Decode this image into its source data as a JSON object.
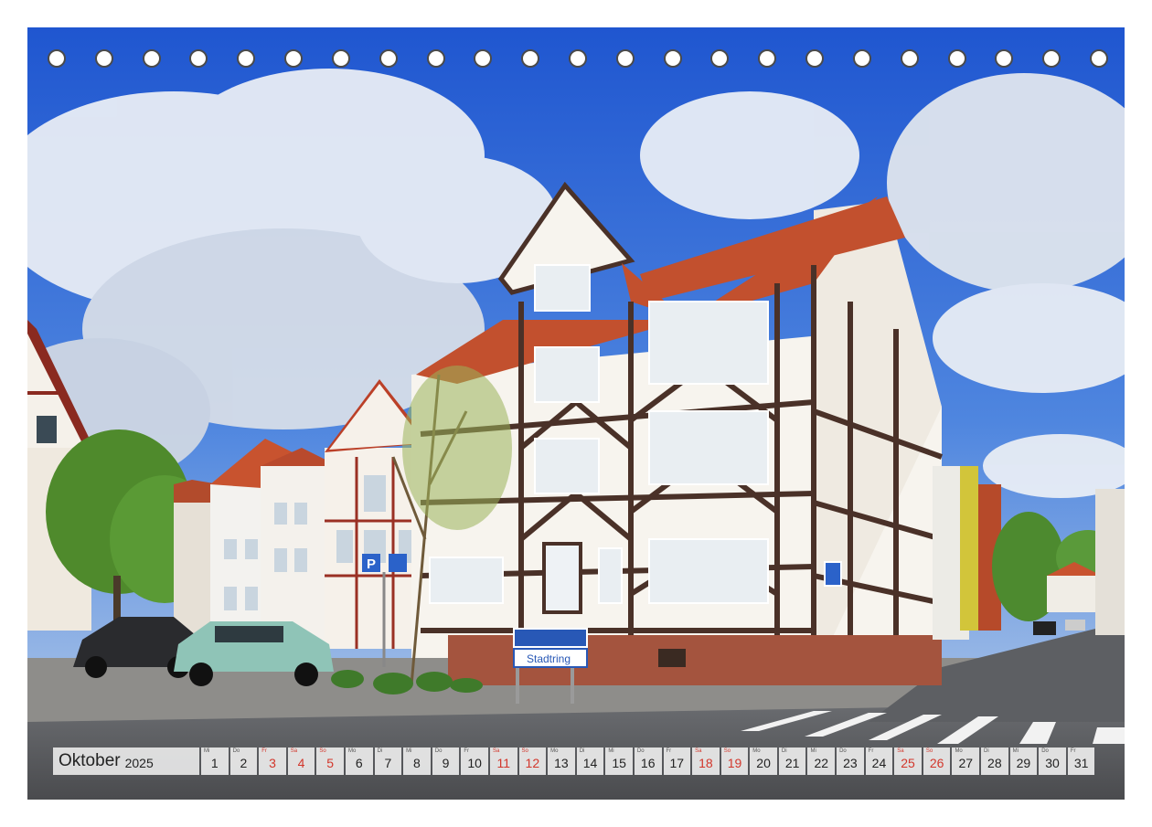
{
  "calendar": {
    "month": "Oktober",
    "year": "2025",
    "weekend_color": "#d2362b",
    "days": [
      {
        "wd": "Mi",
        "n": "1",
        "we": false
      },
      {
        "wd": "Do",
        "n": "2",
        "we": false
      },
      {
        "wd": "Fr",
        "n": "3",
        "we": true
      },
      {
        "wd": "Sa",
        "n": "4",
        "we": true
      },
      {
        "wd": "So",
        "n": "5",
        "we": true
      },
      {
        "wd": "Mo",
        "n": "6",
        "we": false
      },
      {
        "wd": "Di",
        "n": "7",
        "we": false
      },
      {
        "wd": "Mi",
        "n": "8",
        "we": false
      },
      {
        "wd": "Do",
        "n": "9",
        "we": false
      },
      {
        "wd": "Fr",
        "n": "10",
        "we": false
      },
      {
        "wd": "Sa",
        "n": "11",
        "we": true
      },
      {
        "wd": "So",
        "n": "12",
        "we": true
      },
      {
        "wd": "Mo",
        "n": "13",
        "we": false
      },
      {
        "wd": "Di",
        "n": "14",
        "we": false
      },
      {
        "wd": "Mi",
        "n": "15",
        "we": false
      },
      {
        "wd": "Do",
        "n": "16",
        "we": false
      },
      {
        "wd": "Fr",
        "n": "17",
        "we": false
      },
      {
        "wd": "Sa",
        "n": "18",
        "we": true
      },
      {
        "wd": "So",
        "n": "19",
        "we": true
      },
      {
        "wd": "Mo",
        "n": "20",
        "we": false
      },
      {
        "wd": "Di",
        "n": "21",
        "we": false
      },
      {
        "wd": "Mi",
        "n": "22",
        "we": false
      },
      {
        "wd": "Do",
        "n": "23",
        "we": false
      },
      {
        "wd": "Fr",
        "n": "24",
        "we": false
      },
      {
        "wd": "Sa",
        "n": "25",
        "we": true
      },
      {
        "wd": "So",
        "n": "26",
        "we": true
      },
      {
        "wd": "Mo",
        "n": "27",
        "we": false
      },
      {
        "wd": "Di",
        "n": "28",
        "we": false
      },
      {
        "wd": "Mi",
        "n": "29",
        "we": false
      },
      {
        "wd": "Do",
        "n": "30",
        "we": false
      },
      {
        "wd": "Fr",
        "n": "31",
        "we": false
      }
    ]
  },
  "photo": {
    "street_sign": "Stadtring",
    "parking_sign": "P"
  },
  "binding": {
    "hole_count": 23
  }
}
